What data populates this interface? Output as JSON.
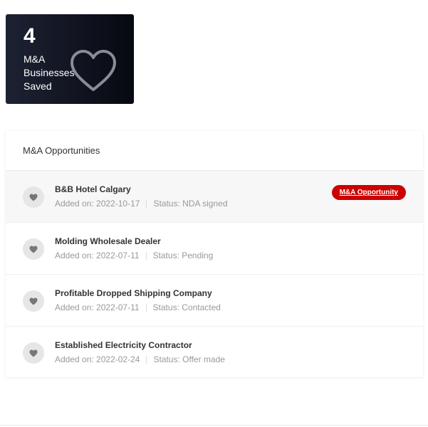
{
  "stat": {
    "count": "4",
    "label": "M&A Businesses Saved",
    "icon": "heart-outline-icon"
  },
  "panel": {
    "title": "M&A Opportunities",
    "items": [
      {
        "title": "B&B Hotel Calgary",
        "added": "Added on: 2022-10-17",
        "status": "Status: NDA signed",
        "badge": "M&A Opportunity"
      },
      {
        "title": "Molding Wholesale Dealer",
        "added": "Added on: 2022-07-11",
        "status": "Status: Pending"
      },
      {
        "title": "Profitable Dropped Shipping Company",
        "added": "Added on: 2022-07-11",
        "status": "Status: Contacted"
      },
      {
        "title": "Established Electricity Contractor",
        "added": "Added on: 2022-02-24",
        "status": "Status: Offer made"
      }
    ]
  },
  "colors": {
    "badge": "#cc0000",
    "card_dark": "#10131f"
  }
}
